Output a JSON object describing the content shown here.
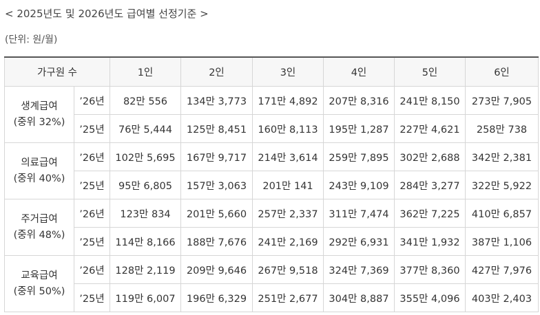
{
  "title": "< 2025년도 및 2026년도 급여별 선정기준 >",
  "unit": "(단위: 원/월)",
  "header": {
    "household": "가구원 수",
    "cols": [
      "1인",
      "2인",
      "3인",
      "4인",
      "5인",
      "6인"
    ]
  },
  "groups": [
    {
      "name": "생계급여",
      "sub": "(중위 32%)",
      "rows": [
        {
          "year": "’26년",
          "values": [
            "82만 556",
            "134만 3,773",
            "171만 4,892",
            "207만 8,316",
            "241만 8,150",
            "273만 7,905"
          ]
        },
        {
          "year": "’25년",
          "values": [
            "76만 5,444",
            "125만 8,451",
            "160만 8,113",
            "195만 1,287",
            "227만 4,621",
            "258만 738"
          ]
        }
      ]
    },
    {
      "name": "의료급여",
      "sub": "(중위 40%)",
      "rows": [
        {
          "year": "’26년",
          "values": [
            "102만 5,695",
            "167만 9,717",
            "214만 3,614",
            "259만 7,895",
            "302만 2,688",
            "342만 2,381"
          ]
        },
        {
          "year": "’25년",
          "values": [
            "95만 6,805",
            "157만 3,063",
            "201만 141",
            "243만 9,109",
            "284만 3,277",
            "322만 5,922"
          ]
        }
      ]
    },
    {
      "name": "주거급여",
      "sub": "(중위 48%)",
      "rows": [
        {
          "year": "’26년",
          "values": [
            "123만 834",
            "201만 5,660",
            "257만 2,337",
            "311만 7,474",
            "362만 7,225",
            "410만 6,857"
          ]
        },
        {
          "year": "’25년",
          "values": [
            "114만 8,166",
            "188만 7,676",
            "241만 2,169",
            "292만 6,931",
            "341만 1,932",
            "387만 1,106"
          ]
        }
      ]
    },
    {
      "name": "교육급여",
      "sub": "(중위 50%)",
      "rows": [
        {
          "year": "’26년",
          "values": [
            "128만 2,119",
            "209만 9,646",
            "267만 9,518",
            "324만 7,369",
            "377만 8,360",
            "427만 7,976"
          ]
        },
        {
          "year": "’25년",
          "values": [
            "119만 6,007",
            "196만 6,329",
            "251만 2,677",
            "304만 8,887",
            "355만 4,096",
            "403만 2,403"
          ]
        }
      ]
    }
  ]
}
